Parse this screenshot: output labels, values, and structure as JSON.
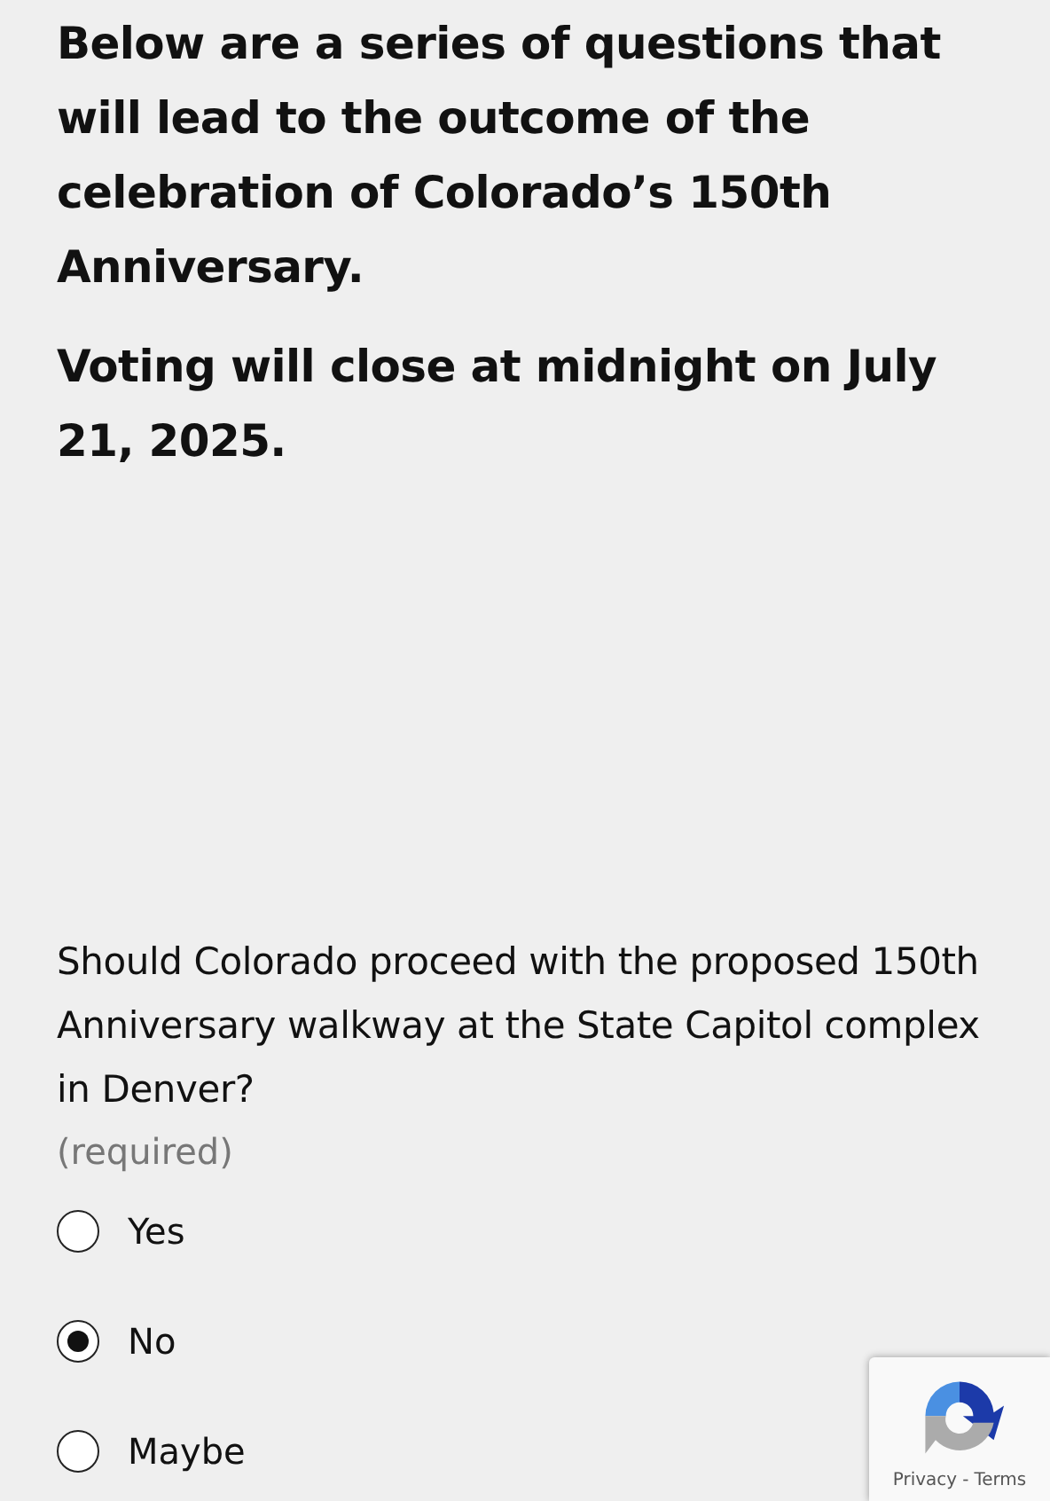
{
  "intro": [
    "Below are a series of questions that will lead to the outcome of the celebration of Colorado’s 150th Anniversary.",
    "Voting will close at midnight on July 21, 2025."
  ],
  "question": {
    "text": "Should Colorado proceed with the proposed 150th Anniversary walkway at the State Capitol complex in Denver?",
    "note": "(required)",
    "options": [
      {
        "label": "Yes",
        "selected": false
      },
      {
        "label": "No",
        "selected": true
      },
      {
        "label": "Maybe",
        "selected": false
      }
    ]
  },
  "badge": {
    "links": [
      "Privacy",
      "-",
      "Terms"
    ]
  }
}
